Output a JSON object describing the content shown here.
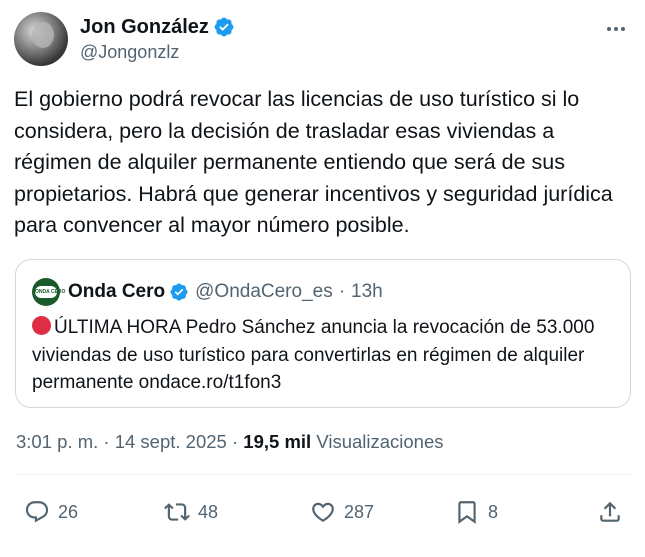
{
  "author": {
    "display_name": "Jon González",
    "handle": "@Jongonzlz",
    "verified": true
  },
  "tweet": {
    "text": "El gobierno podrá revocar las licencias de uso turístico si lo considera, pero la decisión de trasladar esas viviendas a régimen de alquiler permanente entiendo que será de sus propietarios. Habrá que generar incentivos y seguridad jurídica para convencer al mayor número posible."
  },
  "quoted": {
    "display_name": "Onda Cero",
    "handle": "@OndaCero_es",
    "separator": "·",
    "time": "13h",
    "logo_text": "ONDA CERO",
    "text": "ÚLTIMA HORA Pedro Sánchez anuncia la revocación de 53.000 viviendas de uso turístico para convertirlas en régimen de alquiler permanente ondace.ro/t1fon3"
  },
  "meta": {
    "time": "3:01 p. m.",
    "separator": "·",
    "date": "14 sept. 2025",
    "views_count": "19,5 mil",
    "views_label": "Visualizaciones"
  },
  "actions": {
    "replies": "26",
    "reposts": "48",
    "likes": "287",
    "bookmarks": "8"
  },
  "colors": {
    "text": "#0f1419",
    "secondary": "#536471",
    "verified_blue": "#1d9bf0",
    "border": "#cfd9de",
    "red_circle": "#dd2e44"
  }
}
